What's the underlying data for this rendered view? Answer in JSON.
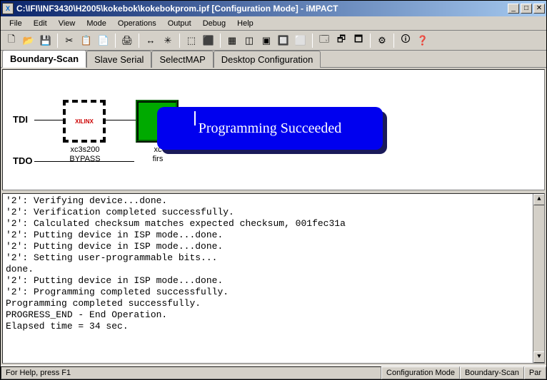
{
  "titlebar": {
    "title": "C:\\IFI\\INF3430\\H2005\\kokebok\\kokebokprom.ipf [Configuration Mode]  - iMPACT",
    "app_icon_text": "X"
  },
  "menu": {
    "items": [
      "File",
      "Edit",
      "View",
      "Mode",
      "Operations",
      "Output",
      "Debug",
      "Help"
    ]
  },
  "toolbar": {
    "icons": [
      "🗋",
      "📂",
      "💾",
      "✂",
      "📋",
      "📄",
      "🖨",
      "↔",
      "✳",
      "⬚",
      "⬛",
      "▦",
      "◫",
      "▣",
      "🔲",
      "⬜",
      "🗔",
      "🗗",
      "🗖",
      "⚙",
      "🛈",
      "❓"
    ]
  },
  "tabs": {
    "items": [
      "Boundary-Scan",
      "Slave Serial",
      "SelectMAP",
      "Desktop Configuration"
    ],
    "active": 0
  },
  "canvas": {
    "tdi": "TDI",
    "tdo": "TDO",
    "chip1": {
      "logo": "XILINX",
      "label_line1": "xc3s200",
      "label_line2": "BYPASS"
    },
    "chip2": {
      "label_line1": "xc",
      "label_line2": "firs"
    },
    "tooltip": "Programming Succeeded"
  },
  "log": {
    "lines": [
      "'2': Verifying device...done.",
      "'2': Verification completed successfully.",
      "'2': Calculated checksum matches expected checksum, 001fec31a",
      "'2': Putting device in ISP mode...done.",
      "'2': Putting device in ISP mode...done.",
      "'2': Setting user-programmable bits...",
      "done.",
      "'2': Putting device in ISP mode...done.",
      "'2': Programming completed successfully.",
      "Programming completed successfully.",
      "PROGRESS_END - End Operation.",
      "Elapsed time =     34 sec."
    ]
  },
  "statusbar": {
    "help": "For Help, press F1",
    "mode": "Configuration Mode",
    "scan": "Boundary-Scan",
    "extra": "Par"
  }
}
